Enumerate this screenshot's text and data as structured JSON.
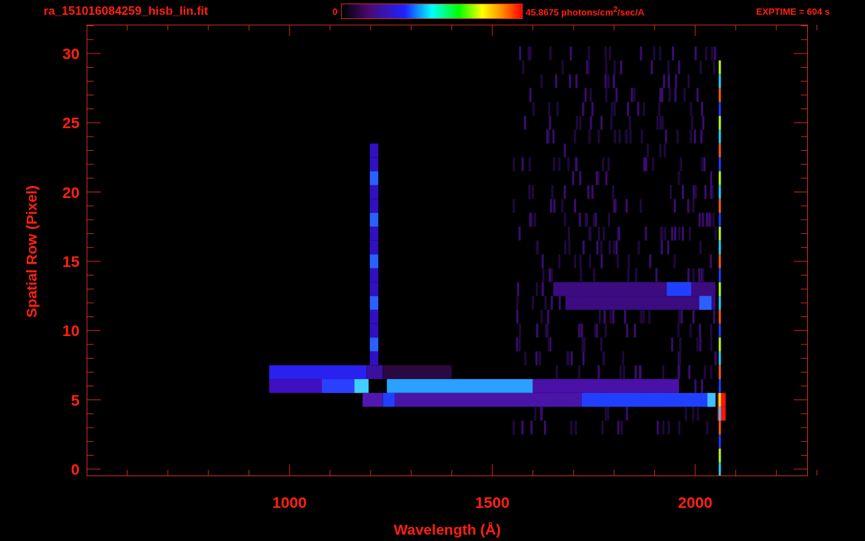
{
  "header": {
    "file_name": "ra_151016084259_hisb_lin.fit",
    "color_scale": {
      "min_label": "0",
      "max_label": "45.8675 photons/cm$^{2}$/sec/A"
    },
    "exposure": "EXPTIME = 604 s"
  },
  "plot": {
    "y_axis": {
      "title": "Spatial Row (Pixel)",
      "tick_labels": [
        "30",
        "25",
        "20",
        "15",
        "10",
        "5",
        "0"
      ]
    },
    "x_axis": {
      "title": "Wavelength (Å)",
      "tick_labels": [
        "1000",
        "1500",
        "2000"
      ]
    }
  }
}
